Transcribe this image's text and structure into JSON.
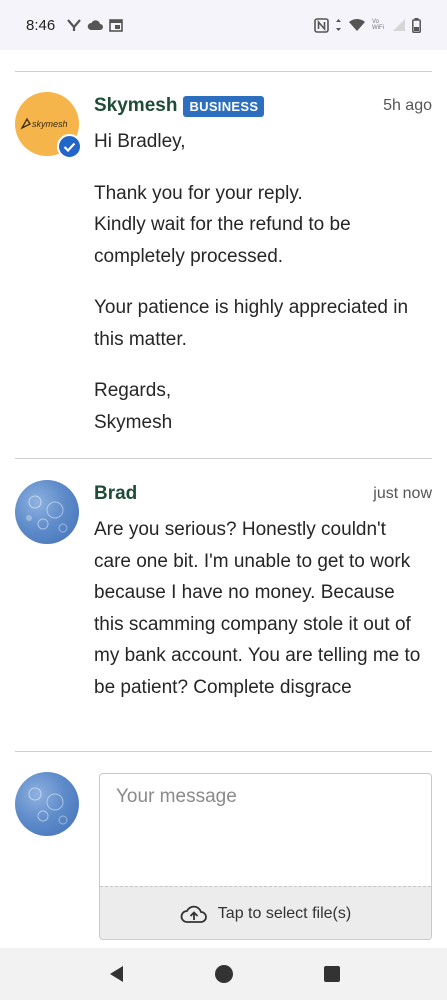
{
  "status_bar": {
    "time": "8:46",
    "left_icons": [
      "carrier-y-icon",
      "cloud-icon",
      "calendar-icon"
    ],
    "right_icons": [
      "nfc-icon",
      "data-arrows-icon",
      "wifi-icon",
      "signal-icon",
      "battery-icon"
    ],
    "wifi_label": "Vo WiFi"
  },
  "messages": [
    {
      "sender": "Skymesh",
      "badge": "BUSINESS",
      "time": "5h ago",
      "avatar_logo": "skymesh",
      "verified": true,
      "paragraphs": [
        "Hi Bradley,",
        "Thank you for your reply.\nKindly wait for the refund to be completely processed.",
        "Your patience is highly appreciated in this matter.",
        "Regards,\nSkymesh"
      ]
    },
    {
      "sender": "Brad",
      "time": "just now",
      "paragraphs": [
        "Are you serious? Honestly couldn't care one bit. I'm unable to get to work because I have no money. Because this scamming company stole it out of my bank account. You are telling me to be patient? Complete disgrace"
      ]
    }
  ],
  "compose": {
    "placeholder": "Your message",
    "upload_label": "Tap to select file(s)"
  },
  "nav": [
    "back-icon",
    "home-icon",
    "recents-icon"
  ],
  "colors": {
    "accent_blue": "#2d6fbf",
    "sender_green": "#1f4b38",
    "avatar_orange": "#f6b54a"
  }
}
